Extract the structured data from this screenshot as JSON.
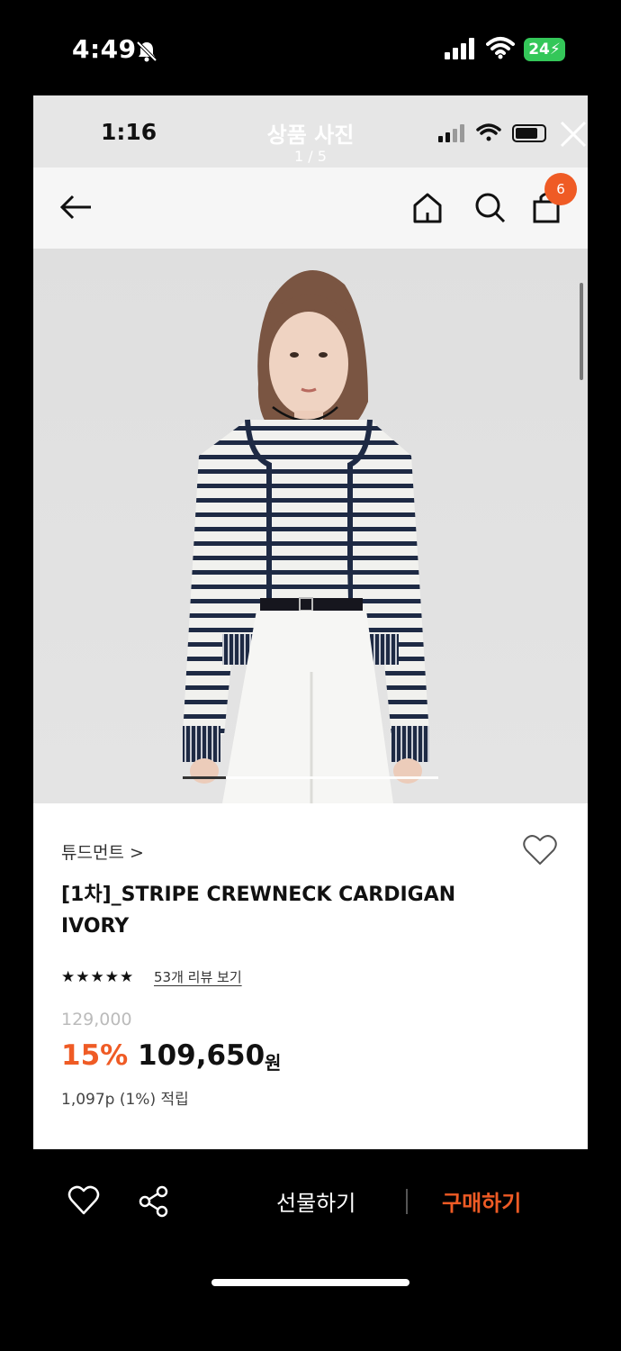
{
  "device": {
    "time": "4:49",
    "battery": "24"
  },
  "screen": {
    "status_time": "1:16",
    "viewer_title": "상품 사진",
    "viewer_counter": "1 / 5"
  },
  "nav": {
    "cart_count": "6"
  },
  "photo": {
    "progress": 0.17
  },
  "product": {
    "brand": "튜드먼트 >",
    "name": "[1차]_STRIPE CREWNECK CARDIGAN IVORY",
    "rating": 4.5,
    "stars": "★★★★★",
    "reviews_link": "53개 리뷰 보기",
    "original_price": "129,000",
    "discount": "15%",
    "sale_price": "109,650",
    "currency": "원",
    "points": "1,097p (1%) 적립"
  },
  "bottom_bar": {
    "gift_label": "선물하기",
    "buy_label": "구매하기"
  },
  "colors": {
    "accent": "#ef5b25",
    "navy_stripe": "#1e2a44"
  }
}
